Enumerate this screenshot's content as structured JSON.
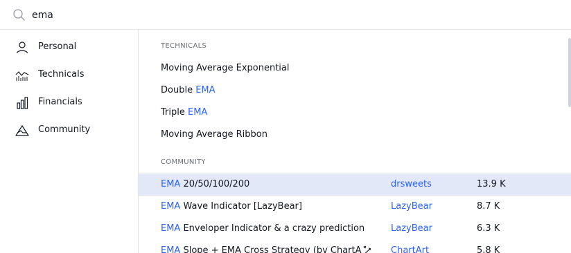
{
  "search": {
    "value": "ema",
    "icon": "search-icon"
  },
  "sidebar": {
    "items": [
      {
        "label": "Personal",
        "icon": "person-icon"
      },
      {
        "label": "Technicals",
        "icon": "technicals-chart-icon"
      },
      {
        "label": "Financials",
        "icon": "bar-chart-icon"
      },
      {
        "label": "Community",
        "icon": "community-icon"
      }
    ]
  },
  "technicals": {
    "header": "TECHNICALS",
    "items": [
      {
        "prefix": "Moving Average Exponential",
        "highlight": ""
      },
      {
        "prefix": "Double ",
        "highlight": "EMA"
      },
      {
        "prefix": "Triple ",
        "highlight": "EMA"
      },
      {
        "prefix": "Moving Average Ribbon",
        "highlight": ""
      }
    ]
  },
  "community": {
    "header": "COMMUNITY",
    "items": [
      {
        "highlight": "EMA",
        "rest": " 20/50/100/200",
        "author": "drsweets",
        "likes": "13.9 K"
      },
      {
        "highlight": "EMA",
        "rest": " Wave Indicator [LazyBear]",
        "author": "LazyBear",
        "likes": "8.7 K"
      },
      {
        "highlight": "EMA",
        "rest": " Enveloper Indicator & a crazy prediction",
        "author": "LazyBear",
        "likes": "6.3 K"
      },
      {
        "highlight": "EMA",
        "rest": " Slope + EMA Cross Strategy (by ChartA",
        "author": "ChartArt",
        "likes": "5.8 K",
        "badge": "strategy-icon"
      }
    ]
  },
  "colors": {
    "accent": "#2962ff",
    "highlight_row": "#e3e8f8",
    "text": "#131722",
    "muted": "#6a6d78",
    "border": "#e0e3eb"
  }
}
